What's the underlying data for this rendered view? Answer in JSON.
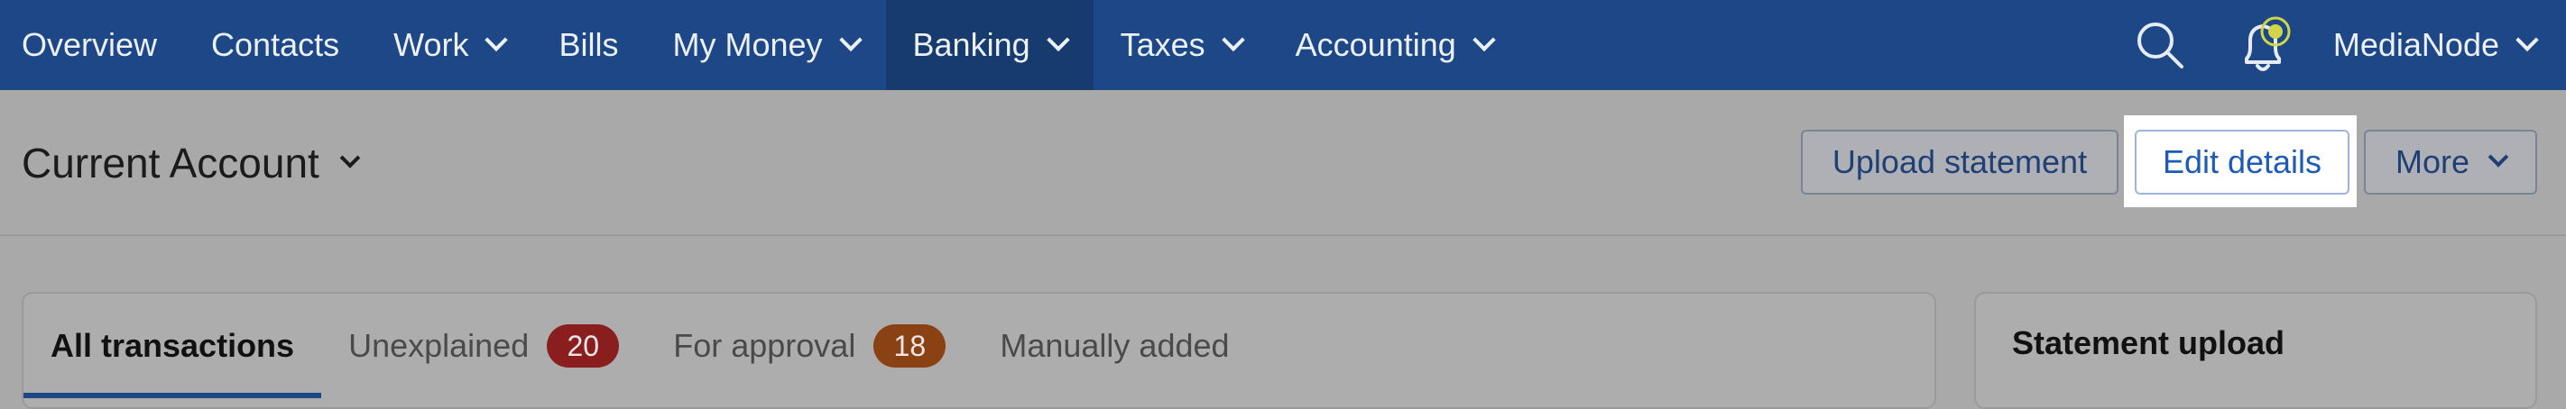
{
  "nav": {
    "items": [
      {
        "label": "Overview",
        "dropdown": false,
        "active": false
      },
      {
        "label": "Contacts",
        "dropdown": false,
        "active": false
      },
      {
        "label": "Work",
        "dropdown": true,
        "active": false
      },
      {
        "label": "Bills",
        "dropdown": false,
        "active": false
      },
      {
        "label": "My Money",
        "dropdown": true,
        "active": false
      },
      {
        "label": "Banking",
        "dropdown": true,
        "active": true
      },
      {
        "label": "Taxes",
        "dropdown": true,
        "active": false
      },
      {
        "label": "Accounting",
        "dropdown": true,
        "active": false
      }
    ],
    "search_icon": "search-icon",
    "notification_icon": "bell-icon",
    "user_label": "MediaNode"
  },
  "page": {
    "title": "Current Account",
    "buttons": {
      "upload": "Upload statement",
      "edit": "Edit details",
      "more": "More"
    }
  },
  "transactions_panel": {
    "tabs": [
      {
        "label": "All transactions",
        "active": true
      },
      {
        "label": "Unexplained",
        "badge": "20",
        "badge_color": "#8a1e1e"
      },
      {
        "label": "For approval",
        "badge": "18",
        "badge_color": "#8a4114"
      },
      {
        "label": "Manually added"
      }
    ]
  },
  "side_panel": {
    "title": "Statement upload"
  },
  "colors": {
    "nav_bg": "#1e4788",
    "nav_active": "#173a6f",
    "accent": "#1c5bb8",
    "notification_dot": "#cfd64a"
  }
}
